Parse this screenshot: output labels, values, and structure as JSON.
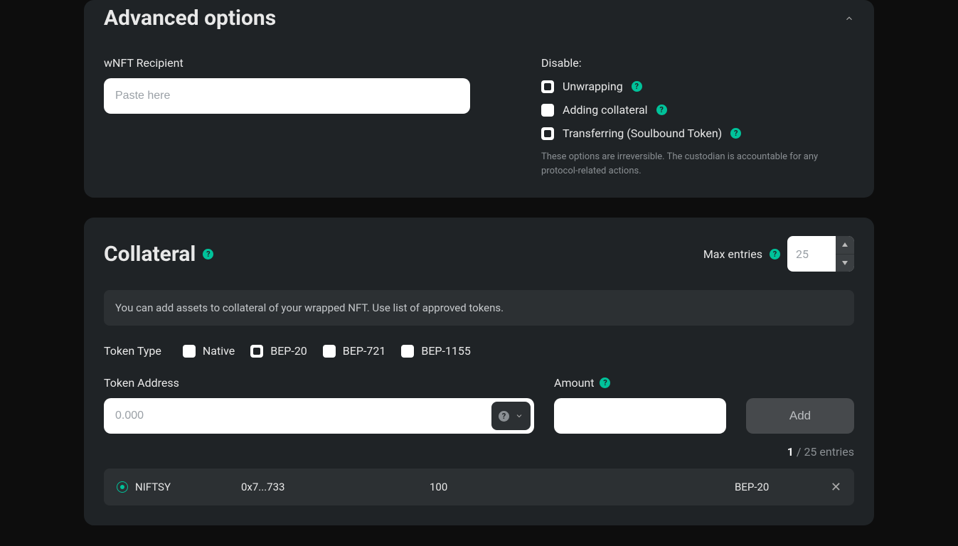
{
  "advanced": {
    "title": "Advanced options",
    "recipient_label": "wNFT Recipient",
    "recipient_placeholder": "Paste here",
    "disable_label": "Disable:",
    "options": [
      {
        "label": "Unwrapping",
        "checked_style": "inner-dark"
      },
      {
        "label": "Adding collateral",
        "checked_style": "solid-white"
      },
      {
        "label": "Transferring (Soulbound Token)",
        "checked_style": "inner-dark"
      }
    ],
    "note": "These options are irreversible. The custodian is accountable for any protocol-related actions."
  },
  "collateral": {
    "title": "Collateral",
    "max_entries_label": "Max entries",
    "max_entries_value": "25",
    "banner": "You can add assets to collateral of your wrapped NFT. Use list of approved tokens.",
    "token_type_label": "Token Type",
    "token_types": [
      {
        "label": "Native",
        "checked_style": "solid-white"
      },
      {
        "label": "BEP-20",
        "checked_style": "inner-dark"
      },
      {
        "label": "BEP-721",
        "checked_style": "solid-white"
      },
      {
        "label": "BEP-1155",
        "checked_style": "solid-white"
      }
    ],
    "address_label": "Token Address",
    "address_placeholder": "0.000",
    "amount_label": "Amount",
    "add_label": "Add",
    "count_current": "1",
    "count_sep": " / ",
    "count_total": "25 entries",
    "entry": {
      "symbol": "NIFTSY",
      "address": "0x7...733",
      "amount": "100",
      "standard": "BEP-20"
    }
  }
}
